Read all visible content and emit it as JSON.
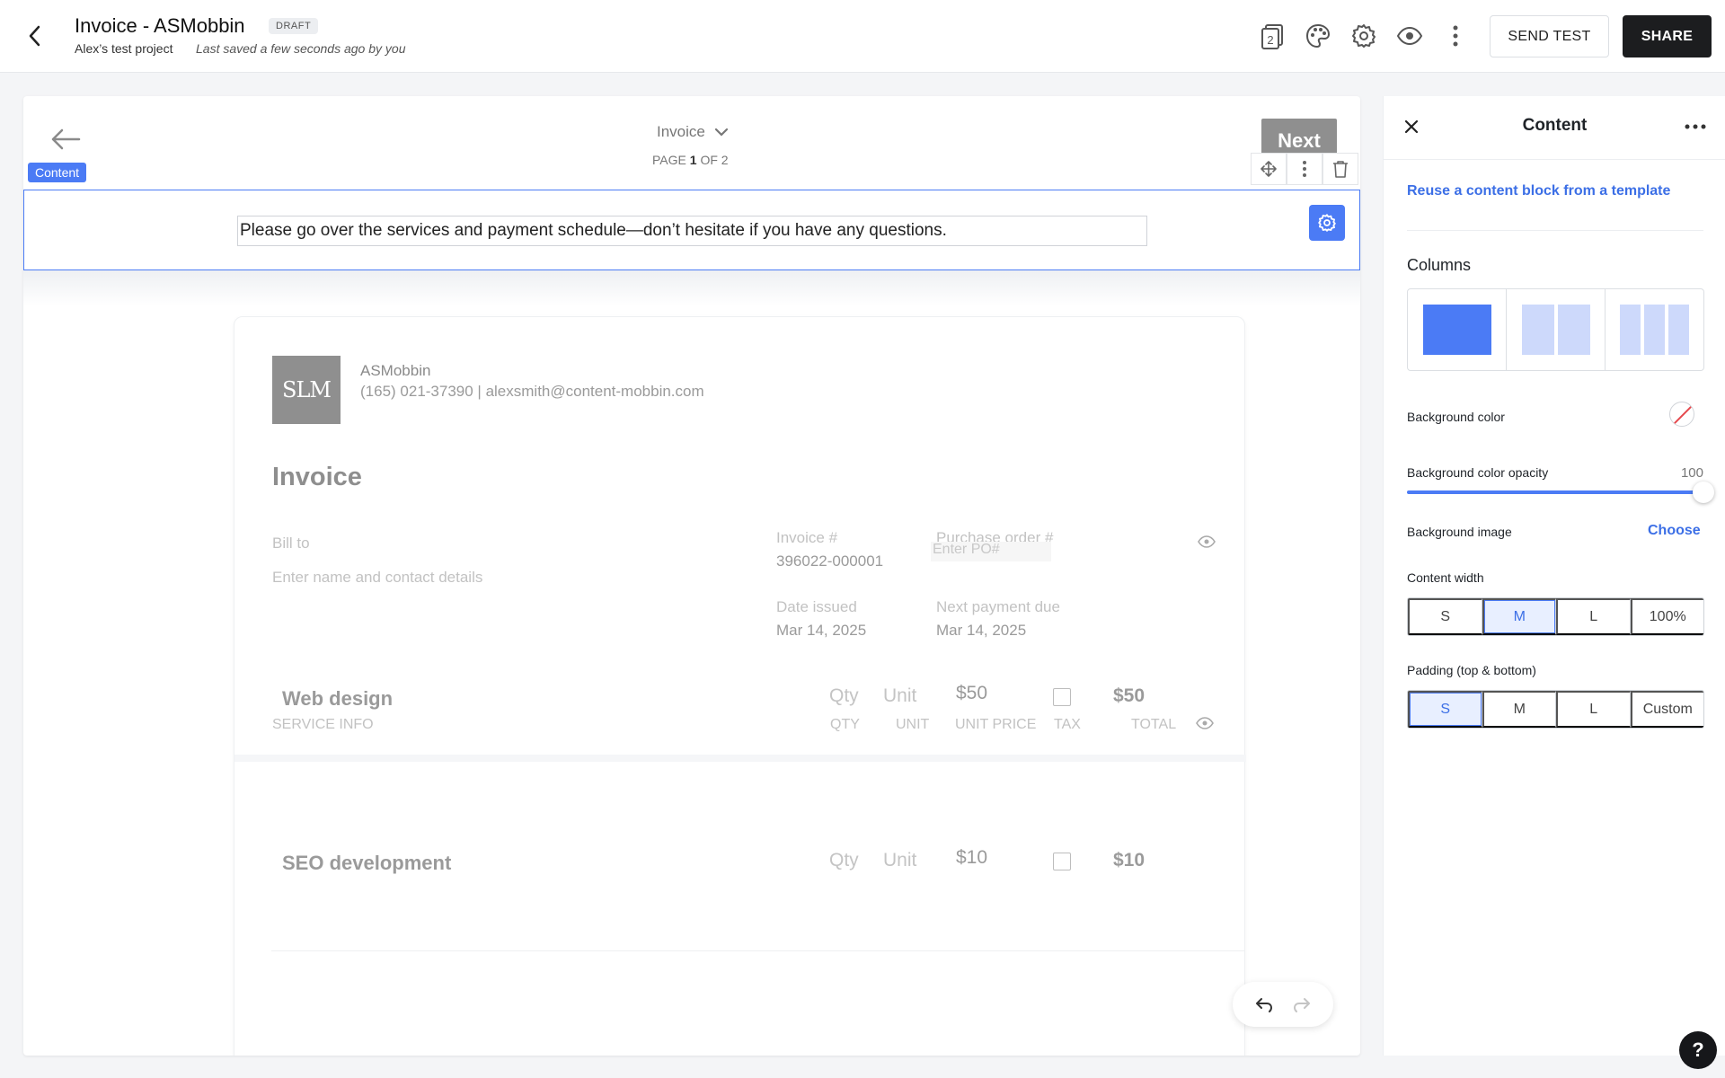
{
  "header": {
    "title": "Invoice - ASMobbin",
    "badge": "DRAFT",
    "project": "Alex’s test project",
    "saved_status": "Last saved a few seconds ago by you",
    "page_count_icon_value": "2",
    "send_test_label": "SEND TEST",
    "share_label": "SHARE"
  },
  "canvas": {
    "page_select_label": "Invoice",
    "page_info_prefix": "PAGE ",
    "page_current": "1",
    "page_info_suffix": " OF 2",
    "next_label": "Next",
    "content_tag": "Content",
    "message": "Please go over the services and payment schedule—don’t hesitate if you have any questions."
  },
  "invoice": {
    "logo_text": "SLM",
    "company_name": "ASMobbin",
    "company_contact": "(165) 021-37390 | alexsmith@content-mobbin.com",
    "heading": "Invoice",
    "bill_to_label": "Bill to",
    "bill_to_placeholder": "Enter name and contact details",
    "invoice_no_label": "Invoice #",
    "invoice_no": "396022-000001",
    "po_label": "Purchase order #",
    "po_placeholder": "Enter PO#",
    "date_issued_label": "Date issued",
    "date_issued": "Mar 14, 2025",
    "next_due_label": "Next payment due",
    "next_due": "Mar 14, 2025",
    "columns": {
      "service": "SERVICE INFO",
      "qty": "QTY",
      "unit": "UNIT",
      "unit_price": "UNIT PRICE",
      "tax": "TAX",
      "total": "TOTAL"
    },
    "items": [
      {
        "name": "Web design",
        "qty": "Qty",
        "unit": "Unit",
        "price": "$50",
        "total": "$50",
        "tax": false
      },
      {
        "name": "SEO development",
        "qty": "Qty",
        "unit": "Unit",
        "price": "$10",
        "total": "$10",
        "tax": false
      }
    ]
  },
  "panel": {
    "title": "Content",
    "reuse_link": "Reuse a content block from a template",
    "columns_label": "Columns",
    "columns_selected": 1,
    "bg_color_label": "Background color",
    "bg_opacity_label": "Background color opacity",
    "bg_opacity_value": "100",
    "bg_image_label": "Background image",
    "choose_label": "Choose",
    "content_width_label": "Content width",
    "content_width_options": [
      "S",
      "M",
      "L",
      "100%"
    ],
    "content_width_selected": "M",
    "padding_label": "Padding (top & bottom)",
    "padding_options": [
      "S",
      "M",
      "L",
      "Custom"
    ],
    "padding_selected": "S"
  },
  "colors": {
    "accent": "#4b7bf5",
    "link": "#3c6fe6",
    "share_bg": "#1c1d1f"
  },
  "help_label": "?"
}
